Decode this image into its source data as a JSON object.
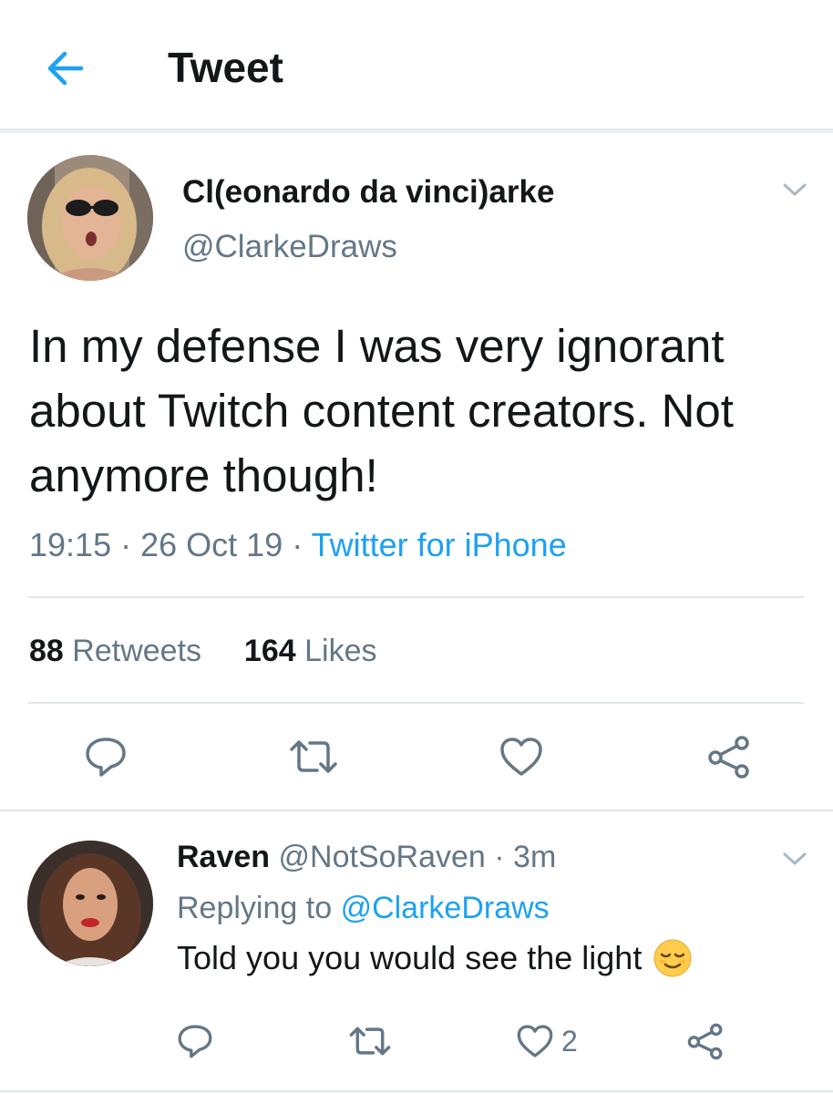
{
  "header": {
    "title": "Tweet",
    "back_icon": "arrow-left-icon"
  },
  "tweet": {
    "display_name": "Cl(eonardo da vinci)arke",
    "handle": "@ClarkeDraws",
    "text": "In my defense I was very ignorant about Twitch content creators. Not anymore though!",
    "time": "19:15",
    "date": "26 Oct 19",
    "separator": "·",
    "source": "Twitter for iPhone",
    "retweets_count": "88",
    "retweets_label": "Retweets",
    "likes_count": "164",
    "likes_label": "Likes",
    "actions": [
      "reply-icon",
      "retweet-icon",
      "like-icon",
      "share-icon"
    ]
  },
  "reply": {
    "display_name": "Raven",
    "handle": "@NotSoRaven",
    "separator": "·",
    "time": "3m",
    "replying_prefix": "Replying to",
    "replying_mention": "@ClarkeDraws",
    "text": "Told you you would see the light",
    "emoji": "relieved-face-emoji",
    "like_count": "2"
  },
  "colors": {
    "accent": "#1da1f2",
    "secondary_text": "#657786",
    "primary_text": "#14171a",
    "divider": "#e1e8ed",
    "icon": "#657786"
  }
}
